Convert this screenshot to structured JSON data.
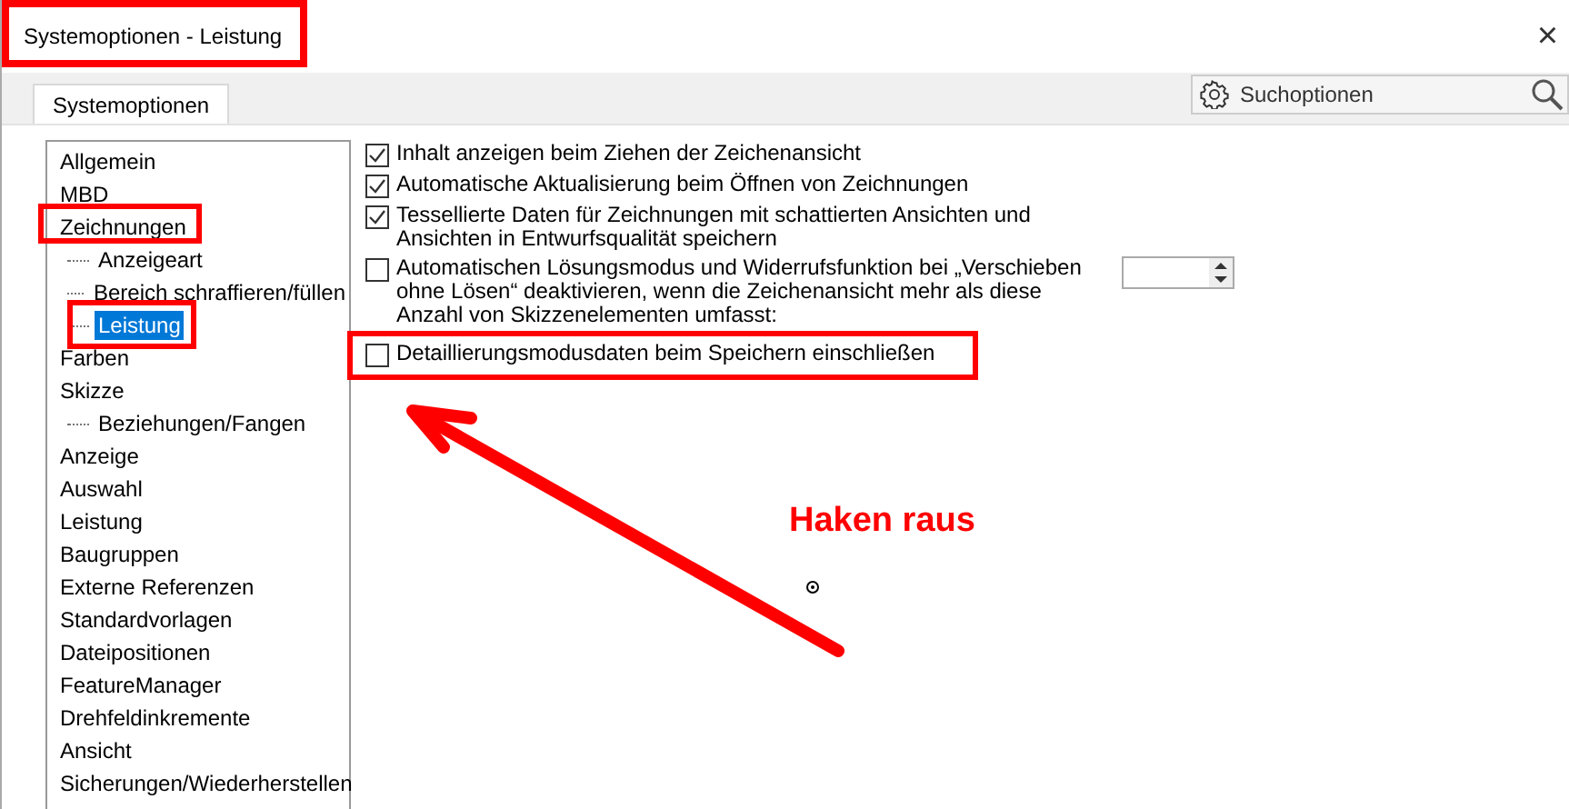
{
  "window": {
    "title": "Systemoptionen - Leistung",
    "close": "×"
  },
  "tabs": [
    {
      "label": "Systemoptionen",
      "selected": true
    }
  ],
  "search": {
    "placeholder": "Suchoptionen"
  },
  "tree": [
    {
      "label": "Allgemein",
      "selected": false
    },
    {
      "label": "MBD",
      "selected": false
    },
    {
      "label": "Zeichnungen",
      "selected": false,
      "children": [
        {
          "label": "Anzeigeart",
          "selected": false
        },
        {
          "label": "Bereich schraffieren/füllen",
          "selected": false
        },
        {
          "label": "Leistung",
          "selected": true
        }
      ]
    },
    {
      "label": "Farben",
      "selected": false
    },
    {
      "label": "Skizze",
      "selected": false,
      "children": [
        {
          "label": "Beziehungen/Fangen",
          "selected": false
        }
      ]
    },
    {
      "label": "Anzeige",
      "selected": false
    },
    {
      "label": "Auswahl",
      "selected": false
    },
    {
      "label": "Leistung",
      "selected": false
    },
    {
      "label": "Baugruppen",
      "selected": false
    },
    {
      "label": "Externe Referenzen",
      "selected": false
    },
    {
      "label": "Standardvorlagen",
      "selected": false
    },
    {
      "label": "Dateipositionen",
      "selected": false
    },
    {
      "label": "FeatureManager",
      "selected": false
    },
    {
      "label": "Drehfeldinkremente",
      "selected": false
    },
    {
      "label": "Ansicht",
      "selected": false
    },
    {
      "label": "Sicherungen/Wiederherstellen",
      "selected": false
    }
  ],
  "options": [
    {
      "label": "Inhalt anzeigen beim Ziehen der Zeichenansicht",
      "checked": true
    },
    {
      "label": "Automatische Aktualisierung beim Öffnen von Zeichnungen",
      "checked": true
    },
    {
      "label": "Tessellierte Daten für Zeichnungen mit schattierten Ansichten und Ansichten in Entwurfsqualität speichern",
      "checked": true
    },
    {
      "label": "Automatischen Lösungsmodus und Widerrufsfunktion bei „Verschieben ohne Lösen“ deaktivieren, wenn die Zeichenansicht mehr als diese Anzahl von Skizzenelementen umfasst:",
      "checked": false,
      "spinner": true
    },
    {
      "label": "Detaillierungsmodusdaten beim Speichern einschließen",
      "checked": false
    }
  ],
  "annotation": {
    "text": "Haken raus"
  }
}
